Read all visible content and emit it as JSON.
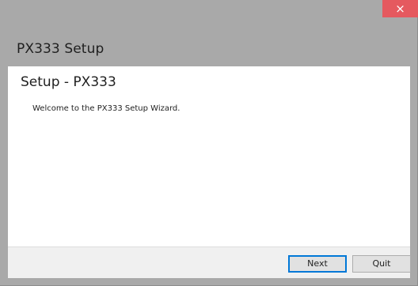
{
  "window": {
    "close_glyph": "×"
  },
  "app_title": "PX333 Setup",
  "content": {
    "heading": "Setup - PX333",
    "welcome_text": "Welcome to the PX333 Setup Wizard."
  },
  "footer": {
    "next_label": "Next",
    "quit_label": "Quit"
  },
  "colors": {
    "close_button": "#e5595f",
    "window_background": "#a9a9a9",
    "footer_background": "#f0f0f0",
    "default_button_border": "#0078d7"
  }
}
